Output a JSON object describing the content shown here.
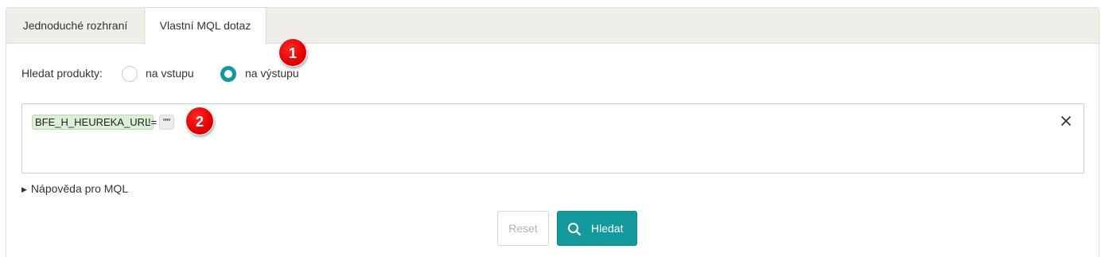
{
  "tabs": [
    {
      "label": "Jednoduché rozhraní"
    },
    {
      "label": "Vlastní MQL dotaz"
    }
  ],
  "annotations": [
    "1",
    "2"
  ],
  "search_products": {
    "label": "Hledat produkty:",
    "options": [
      {
        "label": "na vstupu",
        "selected": false
      },
      {
        "label": "na výstupu",
        "selected": true
      }
    ]
  },
  "query": {
    "field_token": "BFE_H_HEUREKA_URL",
    "operator": "!=",
    "value_token": "\"\""
  },
  "help": {
    "label": "Nápověda pro MQL"
  },
  "buttons": {
    "reset": "Reset",
    "search": "Hledat"
  },
  "colors": {
    "accent": "#13999c",
    "badge": "#e00000",
    "field_token_bg": "#dcf0d8"
  },
  "icons": [
    "search-icon",
    "close-icon",
    "triangle-right-icon"
  ]
}
